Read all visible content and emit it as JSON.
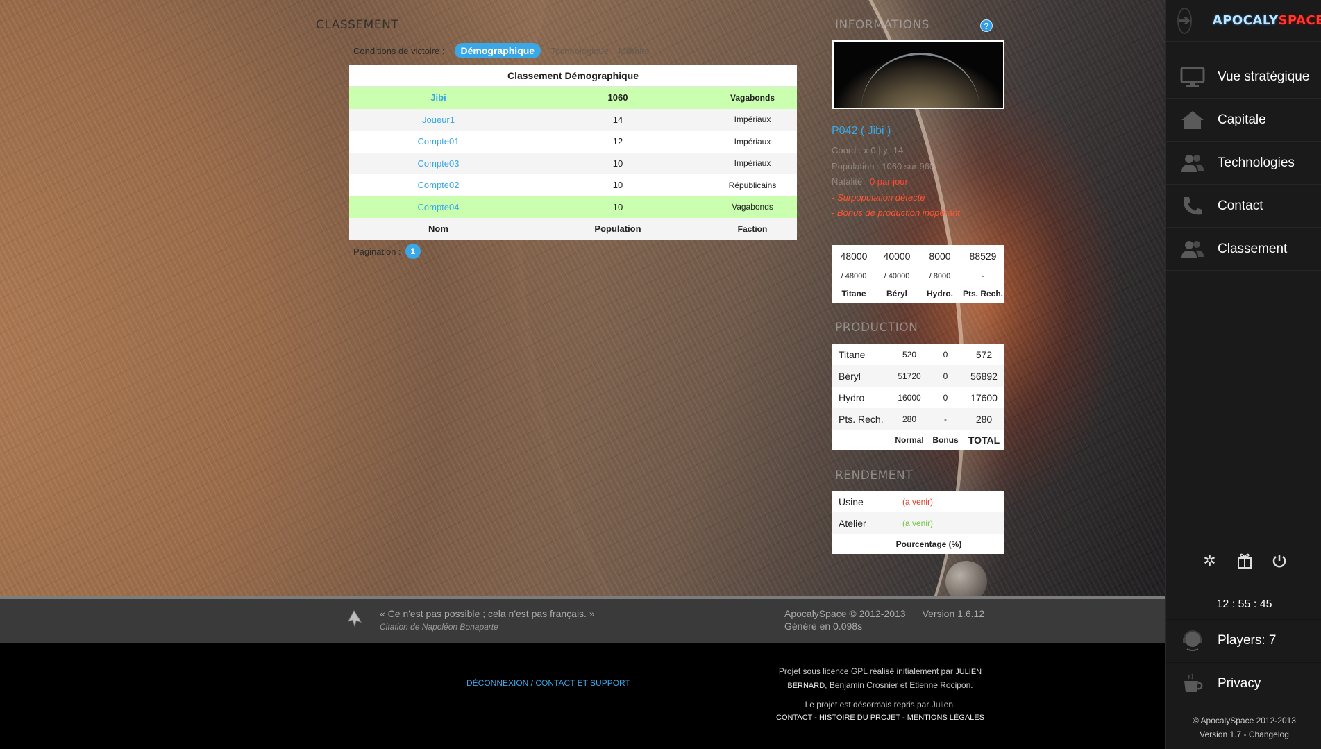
{
  "ranking": {
    "section_title": "CLASSEMENT",
    "victory_label": "Conditions de victoire :",
    "tabs": [
      "Démographique",
      "Technologique",
      "Militaire"
    ],
    "table_title": "Classement Démographique",
    "rows": [
      {
        "name": "Jibi",
        "population": "1060",
        "faction": "Vagabonds"
      },
      {
        "name": "Joueur1",
        "population": "14",
        "faction": "Impériaux"
      },
      {
        "name": "Compte01",
        "population": "12",
        "faction": "Impériaux"
      },
      {
        "name": "Compte03",
        "population": "10",
        "faction": "Impériaux"
      },
      {
        "name": "Compte02",
        "population": "10",
        "faction": "Républicains"
      },
      {
        "name": "Compte04",
        "population": "10",
        "faction": "Vagabonds"
      }
    ],
    "columns": [
      "Nom",
      "Population",
      "Faction"
    ],
    "pagination_label": "Pagination :",
    "page": "1",
    "colors": {
      "accent": "#3aa7e6",
      "highlight": "#c9ffaf"
    }
  },
  "info": {
    "section_title": "INFORMATIONS",
    "help": "?",
    "planet_name": "P042 ( Jibi )",
    "coord": "Coord : x 0 | y -14",
    "population": "Population : 1060 sur 960",
    "natalite_label": "Natalité :",
    "natalite_value": "0 par jour",
    "warning1": "- Surpopulation détecté",
    "warning2": "- Bonus de production inopérant",
    "resources": {
      "amounts": [
        "48000",
        "40000",
        "8000",
        "88529"
      ],
      "caps": [
        "/ 48000",
        "/ 40000",
        "/ 8000",
        "-"
      ],
      "names": [
        "Titane",
        "Béryl",
        "Hydro.",
        "Pts. Rech."
      ]
    }
  },
  "production": {
    "section_title": "PRODUCTION",
    "rows": [
      {
        "name": "Titane",
        "normal": "520",
        "bonus": "0",
        "total": "572"
      },
      {
        "name": "Béryl",
        "normal": "51720",
        "bonus": "0",
        "total": "56892"
      },
      {
        "name": "Hydro",
        "normal": "16000",
        "bonus": "0",
        "total": "17600"
      },
      {
        "name": "Pts. Rech.",
        "normal": "280",
        "bonus": "-",
        "total": "280"
      }
    ],
    "columns": [
      "Normal",
      "Bonus",
      "TOTAL"
    ]
  },
  "rendement": {
    "section_title": "RENDEMENT",
    "rows": [
      {
        "name": "Usine",
        "value": "(a venir)"
      },
      {
        "name": "Atelier",
        "value": "(a venir)"
      }
    ],
    "column": "Pourcentage (%)"
  },
  "footer": {
    "quote": "« Ce n'est pas possible ; cela n'est pas français. »",
    "quote_author": "Citation de Napoléon Bonaparte",
    "copyright": "ApocalySpace © 2012-2013",
    "version": "Version 1.6.12",
    "generated": "Généré en 0.098s",
    "link_logout": "DÉCONNEXION",
    "link_sep": " / ",
    "link_support": "CONTACT ET SUPPORT",
    "credits_line1": "Projet sous licence GPL réalisé initialement par ",
    "credits_name": "Julien Bernard",
    "credits_line2": ", Benjamin Crosnier et Etienne Rocipon.",
    "credits_line3": "Le projet est désormais repris par Julien.",
    "credits_links": "Contact - Histoire du projet - Mentions légales"
  },
  "sidebar": {
    "logo_main": "APOCALY",
    "logo_accent": "SPACE",
    "items": [
      {
        "label": "Vue stratégique",
        "icon": "monitor-icon"
      },
      {
        "label": "Capitale",
        "icon": "home-icon"
      },
      {
        "label": "Technologies",
        "icon": "users-icon"
      },
      {
        "label": "Contact",
        "icon": "phone-icon"
      },
      {
        "label": "Classement",
        "icon": "users-icon"
      }
    ],
    "clock": "12 : 55 : 45",
    "players": "Players: 7",
    "privacy": "Privacy",
    "footer_copy": "© ApocalySpace 2012-2013",
    "footer_version": "Version 1.7 - Changelog"
  }
}
